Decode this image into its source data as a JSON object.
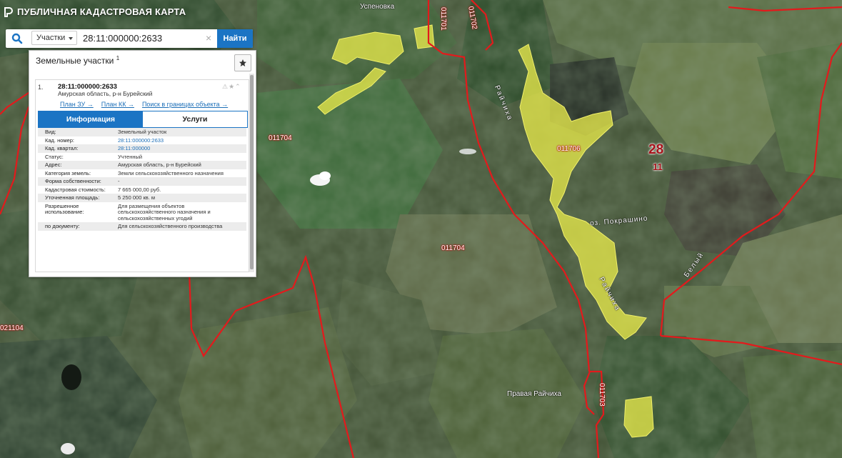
{
  "header": {
    "title": "ПУБЛИЧНАЯ КАДАСТРОВАЯ КАРТА"
  },
  "search": {
    "type_select": "Участки",
    "query": "28:11:000000:2633",
    "button_label": "Найти",
    "clear_symbol": "×"
  },
  "panel": {
    "heading": "Земельные участки",
    "count": "1",
    "item": {
      "num": "1.",
      "cad": "28:11:000000:2633",
      "address": "Амурская область, р-н Бурейский",
      "icons": "⚠★⌃"
    },
    "links": [
      "План ЗУ →",
      "План КК →",
      "Поиск в границах объекта →"
    ],
    "tabs": [
      "Информация",
      "Услуги"
    ],
    "rows": [
      {
        "k": "Вид:",
        "v": "Земельный участок"
      },
      {
        "k": "Кад. номер:",
        "v": "28:11:000000:2633"
      },
      {
        "k": "Кад. квартал:",
        "v": "28:11:000000"
      },
      {
        "k": "Статус:",
        "v": "Учтенный"
      },
      {
        "k": "Адрес:",
        "v": "Амурская область, р-н Бурейский"
      },
      {
        "k": "Категория земель:",
        "v": "Земли сельскохозяйственного назначения"
      },
      {
        "k": "Форма собственности:",
        "v": "-"
      },
      {
        "k": "Кадастровая стоимость:",
        "v": "7 665 000,00 руб."
      },
      {
        "k": "Уточненная площадь:",
        "v": "5 250 000 кв. м"
      },
      {
        "k": "Разрешенное использование:",
        "v": "Для размещения объектов сельскохозяйственного назначения и сельскохозяйственных угодий"
      },
      {
        "k": "по документу:",
        "v": "Для сельскохозяйственного производства"
      }
    ]
  },
  "map": {
    "labels": {
      "uspenovka": "Успеновка",
      "q011701": "011701",
      "q011702": "011702",
      "q011704a": "011704",
      "q011704b": "011704",
      "q011706": "011706",
      "q011703": "011703",
      "q021104": "021104",
      "raychikha1": "Райчиха",
      "raychikha2": "Райчиха",
      "pokrashino": "оз. Покрашино",
      "belaya": "Белый",
      "pravaya": "Правая Райчиха"
    },
    "region": "28",
    "district": "11",
    "colors": {
      "boundary": "#e31a1c",
      "parcel": "#e5e84a",
      "button": "#1b74c4"
    }
  }
}
